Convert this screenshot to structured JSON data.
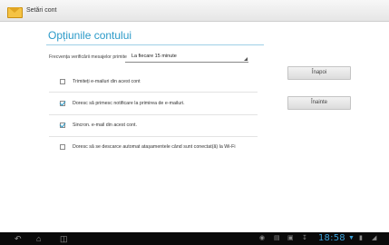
{
  "window": {
    "title": "Setări cont"
  },
  "page": {
    "title": "Opțiunile contului"
  },
  "frequency": {
    "label": "Frecvența verificării mesajelor primite",
    "value": "La fiecare 15 minute"
  },
  "options": [
    {
      "label": "Trimiteți e-mailuri din acest cont",
      "checked": false
    },
    {
      "label": "Doresc să primesc notificare la primirea de e-mailuri.",
      "checked": true
    },
    {
      "label": "Sincron. e-mail din acest cont.",
      "checked": true
    },
    {
      "label": "Doresc să se descarce automat atașamentele când sunt conectat(ă) la Wi-Fi",
      "checked": false
    }
  ],
  "buttons": {
    "back": "Înapoi",
    "next": "Înainte"
  },
  "statusbar": {
    "time": "18:58",
    "icons": [
      "back-icon",
      "home-icon",
      "recent-apps-icon",
      "gamepad-icon",
      "keyboard-icon",
      "gallery-icon",
      "download-icon",
      "wifi-icon",
      "battery-icon"
    ]
  }
}
